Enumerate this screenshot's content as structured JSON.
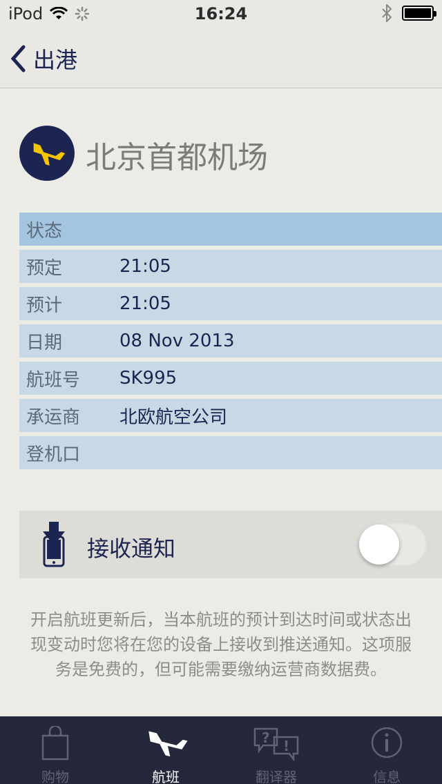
{
  "status_bar": {
    "carrier": "iPod",
    "time": "16:24"
  },
  "nav": {
    "back_label": "出港"
  },
  "airport": {
    "name": "北京首都机场"
  },
  "info": {
    "header": "状态",
    "rows": [
      {
        "label": "预定",
        "value": "21:05"
      },
      {
        "label": "预计",
        "value": "21:05"
      },
      {
        "label": "日期",
        "value": "08 Nov 2013"
      },
      {
        "label": "航班号",
        "value": "SK995"
      },
      {
        "label": "承运商",
        "value": "北欧航空公司"
      },
      {
        "label": "登机口",
        "value": ""
      }
    ]
  },
  "notifications": {
    "label": "接收通知",
    "enabled": false,
    "description": "开启航班更新后，当本航班的预计到达时间或状态出现变动时您将在您的设备上接收到推送通知。这项服务是免费的，但可能需要缴纳运营商数据费。"
  },
  "tabs": [
    {
      "label": "购物",
      "icon": "shopping-bag-icon",
      "active": false
    },
    {
      "label": "航班",
      "icon": "airplane-icon",
      "active": true
    },
    {
      "label": "翻译器",
      "icon": "translator-icon",
      "active": false
    },
    {
      "label": "信息",
      "icon": "info-icon",
      "active": false
    }
  ],
  "colors": {
    "brand_navy": "#1c2451",
    "brand_yellow": "#f5c400",
    "row_bg": "#c8d9e6",
    "header_bg": "#a4c4e0",
    "tab_bar_bg": "#25273a"
  }
}
